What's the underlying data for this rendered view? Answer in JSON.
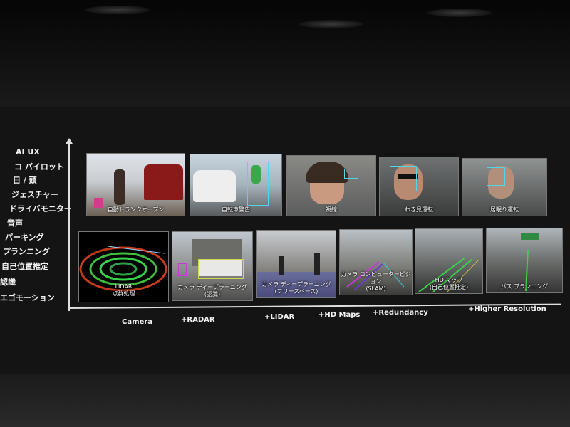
{
  "axis_left_labels": [
    "AI UX",
    "コ パイロット",
    "目 / 頭",
    "ジェスチャー",
    "ドライバモニター",
    "音声",
    "パーキング",
    "プランニング",
    "自己位置推定",
    "認識",
    "エゴモーション"
  ],
  "top_row": [
    {
      "caption": "自動トランクオープン"
    },
    {
      "caption": "自転車警告"
    },
    {
      "caption": "視線"
    },
    {
      "caption": "わき見運転"
    },
    {
      "caption": "居眠り運転"
    }
  ],
  "bottom_row": [
    {
      "caption_line1": "LIDAR",
      "caption_line2": "点群処理"
    },
    {
      "caption_line1": "カメラ ディープラーニング",
      "caption_line2": "(認識)"
    },
    {
      "caption_line1": "カメラ ディープラーニング",
      "caption_line2": "(フリースペース)"
    },
    {
      "caption_line1": "カメラ コンピュータービジョン",
      "caption_line2": "(SLAM)"
    },
    {
      "caption_line1": "HD マップ",
      "caption_line2": "(自己位置推定)"
    },
    {
      "caption_line1": "パス プランニング",
      "caption_line2": ""
    }
  ],
  "x_axis_labels": [
    "Camera",
    "+RADAR",
    "+LIDAR",
    "+HD Maps",
    "+Redundancy",
    "+Higher Resolution"
  ],
  "colors": {
    "screen": "#141414",
    "axis": "#e0e0e0",
    "detect_box": "#4fd7e8"
  }
}
